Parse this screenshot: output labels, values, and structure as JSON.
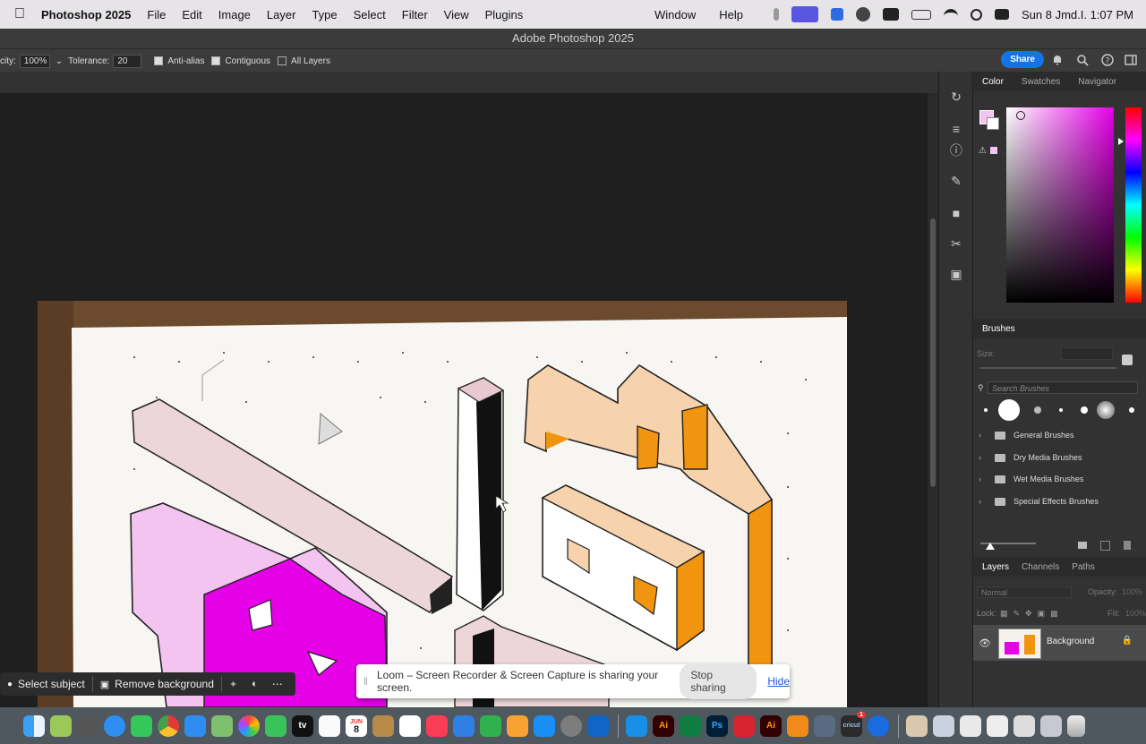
{
  "menubar": {
    "app_name": "Photoshop 2025",
    "menus": [
      "File",
      "Edit",
      "Image",
      "Layer",
      "Type",
      "Select",
      "Filter",
      "View",
      "Plugins",
      "Window",
      "Help"
    ],
    "datetime": "Sun 8 Jmd.I. 1:07 PM"
  },
  "window": {
    "title": "Adobe Photoshop 2025"
  },
  "options": {
    "opacity_label": "city:",
    "opacity_value": "100%",
    "tolerance_label": "Tolerance:",
    "tolerance_value": "20",
    "anti_alias_label": "Anti-alias",
    "anti_alias_checked": true,
    "contiguous_label": "Contiguous",
    "contiguous_checked": true,
    "all_layers_label": "All Layers",
    "all_layers_checked": false,
    "share_label": "Share"
  },
  "color_panel": {
    "tabs": [
      "Color",
      "Swatches",
      "Navigator"
    ],
    "foreground_color": "#f3c4f0",
    "hue_color": "#e500e8"
  },
  "brushes_panel": {
    "title": "Brushes",
    "size_label": "Size:",
    "search_placeholder": "Search Brushes",
    "folders": [
      "General Brushes",
      "Dry Media Brushes",
      "Wet Media Brushes",
      "Special Effects Brushes"
    ]
  },
  "layers_panel": {
    "tabs": [
      "Layers",
      "Channels",
      "Paths"
    ],
    "blend_mode": "Normal",
    "opacity_label": "Opacity:",
    "opacity_value": "100%",
    "lock_label": "Lock:",
    "fill_label": "Fill:",
    "fill_value": "100%",
    "layers": [
      {
        "name": "Background",
        "visible": true,
        "locked": true
      }
    ]
  },
  "context_bar": {
    "select_subject": "Select subject",
    "remove_background": "Remove background"
  },
  "loom_banner": {
    "message": "Loom – Screen Recorder & Screen Capture is sharing your screen.",
    "stop_label": "Stop sharing",
    "hide_label": "Hide"
  },
  "dock": {
    "calendar_month": "JUN",
    "calendar_day": "8",
    "labels": [
      "Ai",
      "Ps",
      "Ai",
      "cricut"
    ],
    "notification_badge": "1"
  }
}
